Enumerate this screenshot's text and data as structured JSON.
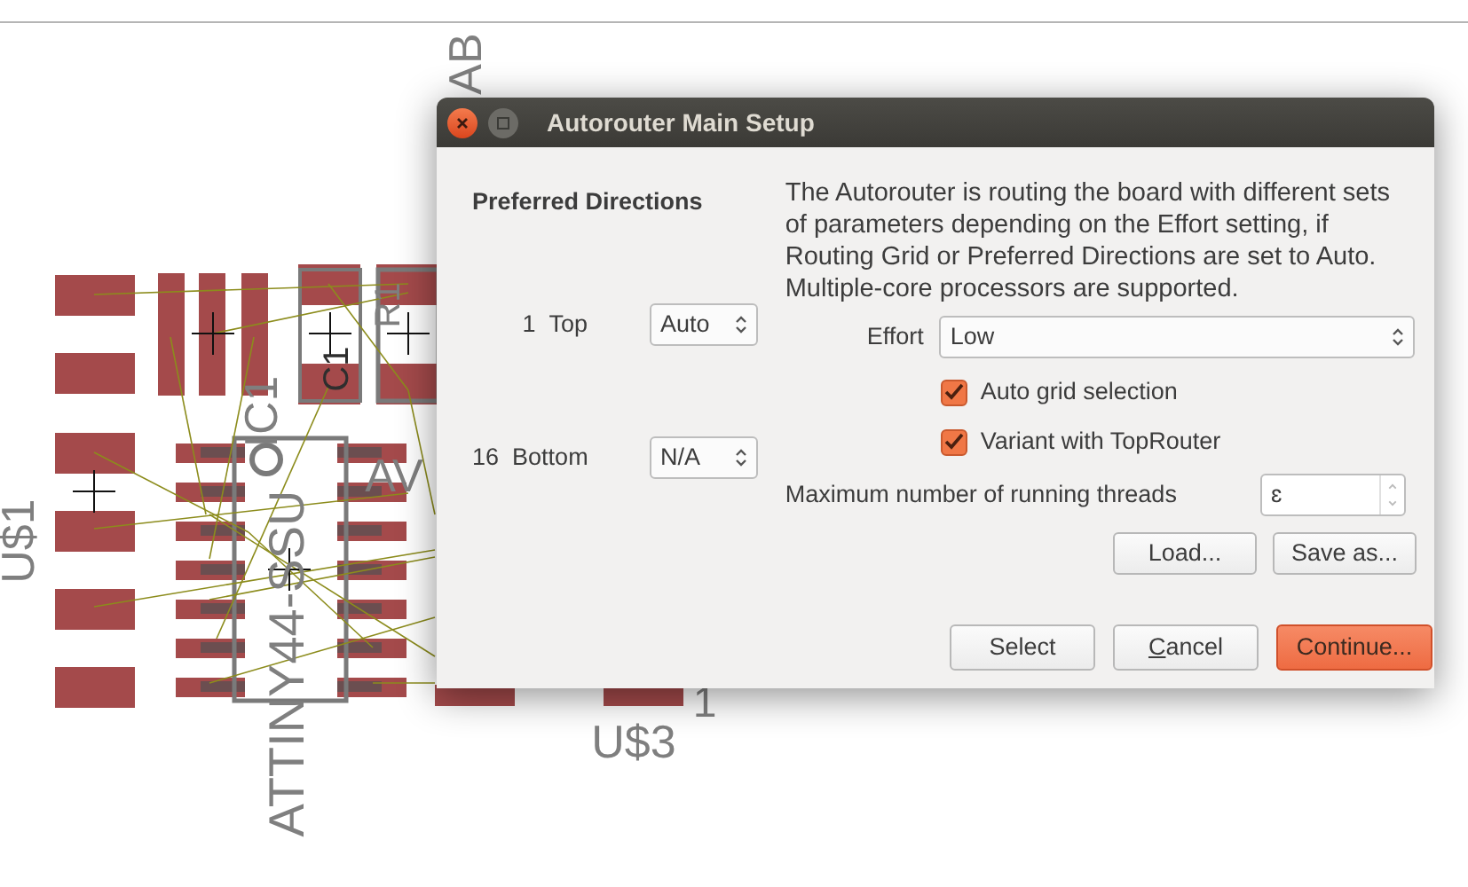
{
  "board": {
    "labels": [
      {
        "text": "AB",
        "kind": "vertical"
      },
      {
        "text": "U$1",
        "kind": "vertical"
      },
      {
        "text": "IC1",
        "kind": "vertical"
      },
      {
        "text": "ATTINY44-SSU",
        "kind": "vertical"
      },
      {
        "text": "C1",
        "kind": "vertical"
      },
      {
        "text": "R1",
        "kind": "vertical"
      },
      {
        "text": "AV",
        "kind": "horizontal"
      },
      {
        "text": "U$3",
        "kind": "horizontal"
      },
      {
        "text": "1",
        "kind": "horizontal"
      }
    ]
  },
  "dialog": {
    "title": "Autorouter Main Setup",
    "preferred_directions": {
      "heading": "Preferred Directions",
      "layers": [
        {
          "number": "1",
          "name": "Top",
          "value": "Auto"
        },
        {
          "number": "16",
          "name": "Bottom",
          "value": "N/A"
        }
      ]
    },
    "description": "The Autorouter is routing the board with different sets of parameters depending on the Effort setting, if Routing Grid or Preferred Directions are set to Auto. Multiple-core processors are supported.",
    "effort": {
      "label": "Effort",
      "value": "Low"
    },
    "options": [
      {
        "label": "Auto grid selection",
        "checked": true
      },
      {
        "label": "Variant with TopRouter",
        "checked": true
      }
    ],
    "threads": {
      "label": "Maximum number of running threads",
      "value": "ɛ"
    },
    "file_buttons": [
      {
        "label": "Load..."
      },
      {
        "label": "Save as..."
      }
    ],
    "footer_buttons": [
      {
        "label": "Select",
        "default": false,
        "underline_first": false
      },
      {
        "label": "Cancel",
        "default": false,
        "underline_first": true
      },
      {
        "label": "Continue...",
        "default": true,
        "underline_first": false
      }
    ]
  }
}
